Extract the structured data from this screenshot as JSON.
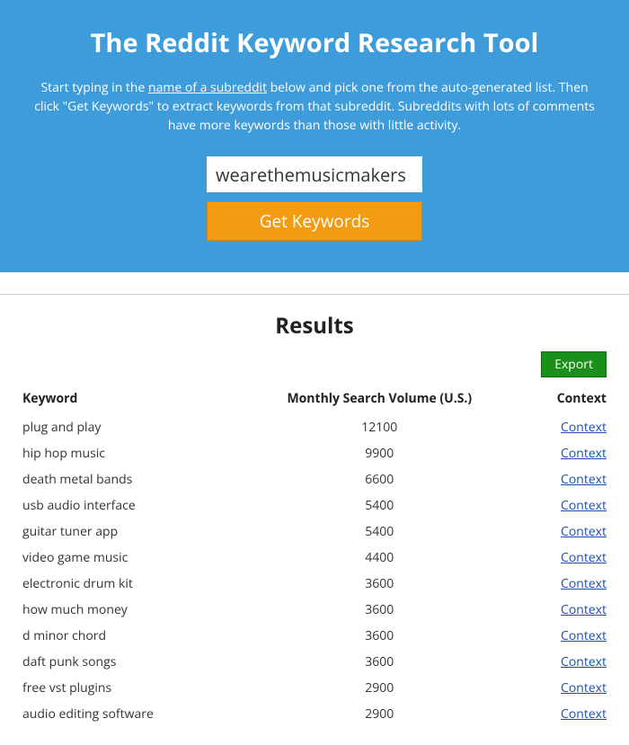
{
  "hero": {
    "title": "The Reddit Keyword Research Tool",
    "intro_before": "Start typing in the ",
    "intro_link": "name of a subreddit",
    "intro_after": " below and pick one from the auto-generated list. Then click \"Get Keywords\" to extract keywords from that subreddit. Subreddits with lots of comments have more keywords than those with little activity.",
    "input_value": "wearethemusicmakers",
    "button_label": "Get Keywords"
  },
  "results": {
    "heading": "Results",
    "export_label": "Export",
    "columns": {
      "keyword": "Keyword",
      "volume": "Monthly Search Volume (U.S.)",
      "context": "Context"
    },
    "context_link_label": "Context",
    "rows": [
      {
        "keyword": "plug and play",
        "volume": "12100"
      },
      {
        "keyword": "hip hop music",
        "volume": "9900"
      },
      {
        "keyword": "death metal bands",
        "volume": "6600"
      },
      {
        "keyword": "usb audio interface",
        "volume": "5400"
      },
      {
        "keyword": "guitar tuner app",
        "volume": "5400"
      },
      {
        "keyword": "video game music",
        "volume": "4400"
      },
      {
        "keyword": "electronic drum kit",
        "volume": "3600"
      },
      {
        "keyword": "how much money",
        "volume": "3600"
      },
      {
        "keyword": "d minor chord",
        "volume": "3600"
      },
      {
        "keyword": "daft punk songs",
        "volume": "3600"
      },
      {
        "keyword": "free vst plugins",
        "volume": "2900"
      },
      {
        "keyword": "audio editing software",
        "volume": "2900"
      }
    ]
  }
}
